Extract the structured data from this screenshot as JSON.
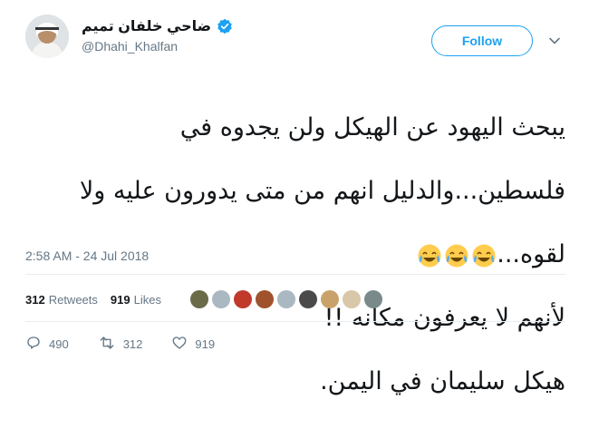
{
  "header": {
    "display_name": "ضاحي خلفان تميم",
    "handle": "@Dhahi_Khalfan",
    "follow_label": "Follow"
  },
  "tweet": {
    "lines": [
      "يبحث اليهود عن الهيكل ولن يجدوه في",
      "فلسطين...والدليل انهم من متى يدورون عليه ولا",
      "لقوه...",
      "لأنهم لا يعرفون مكانه !!",
      "هيكل سليمان في اليمن."
    ],
    "emojis": [
      "face-with-tears-of-joy-icon",
      "face-with-tears-of-joy-icon",
      "face-with-tears-of-joy-icon"
    ],
    "timestamp": "2:58 AM - 24 Jul 2018"
  },
  "stats": {
    "retweets_count": "312",
    "retweets_label": "Retweets",
    "likes_count": "919",
    "likes_label": "Likes"
  },
  "actions": {
    "reply_count": "490",
    "retweet_count": "312",
    "like_count": "919"
  },
  "colors": {
    "accent": "#1da1f2",
    "muted": "#657786",
    "divider": "#e6ecf0"
  }
}
